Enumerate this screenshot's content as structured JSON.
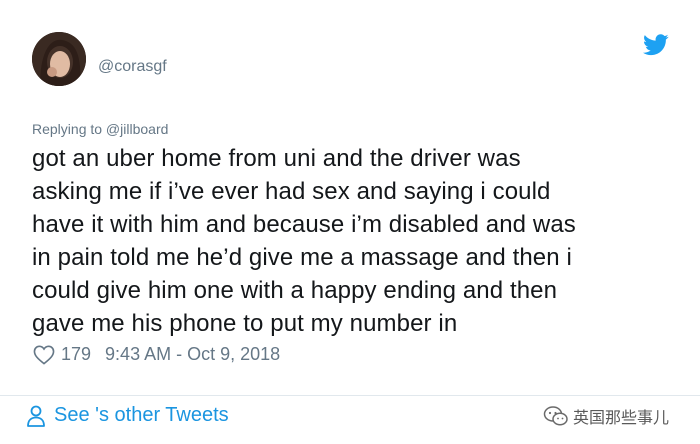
{
  "tweet": {
    "handle": "@corasgf",
    "replying_to": "Replying to @jillboard",
    "lines": [
      "got an uber home from uni and the driver was",
      "asking me if i’ve ever had sex and saying i could",
      "have it with him and because i’m disabled and was",
      "in pain told me he’d give me a massage and then i",
      "could give him one with a happy ending and then",
      "gave me his phone to put my number in"
    ],
    "likes": "179",
    "timestamp": "9:43 AM - Oct 9, 2018"
  },
  "footer": {
    "see_tweets": "See 's other Tweets"
  },
  "watermark": {
    "text": "英国那些事儿"
  },
  "icons": {
    "brand": "twitter-bird-icon",
    "like": "heart-icon",
    "profile": "person-icon",
    "watermark": "wechat-icon"
  },
  "colors": {
    "twitter_blue": "#1da1f2",
    "link_blue": "#1b95e0",
    "muted_gray": "#657786",
    "text": "#14171a"
  }
}
